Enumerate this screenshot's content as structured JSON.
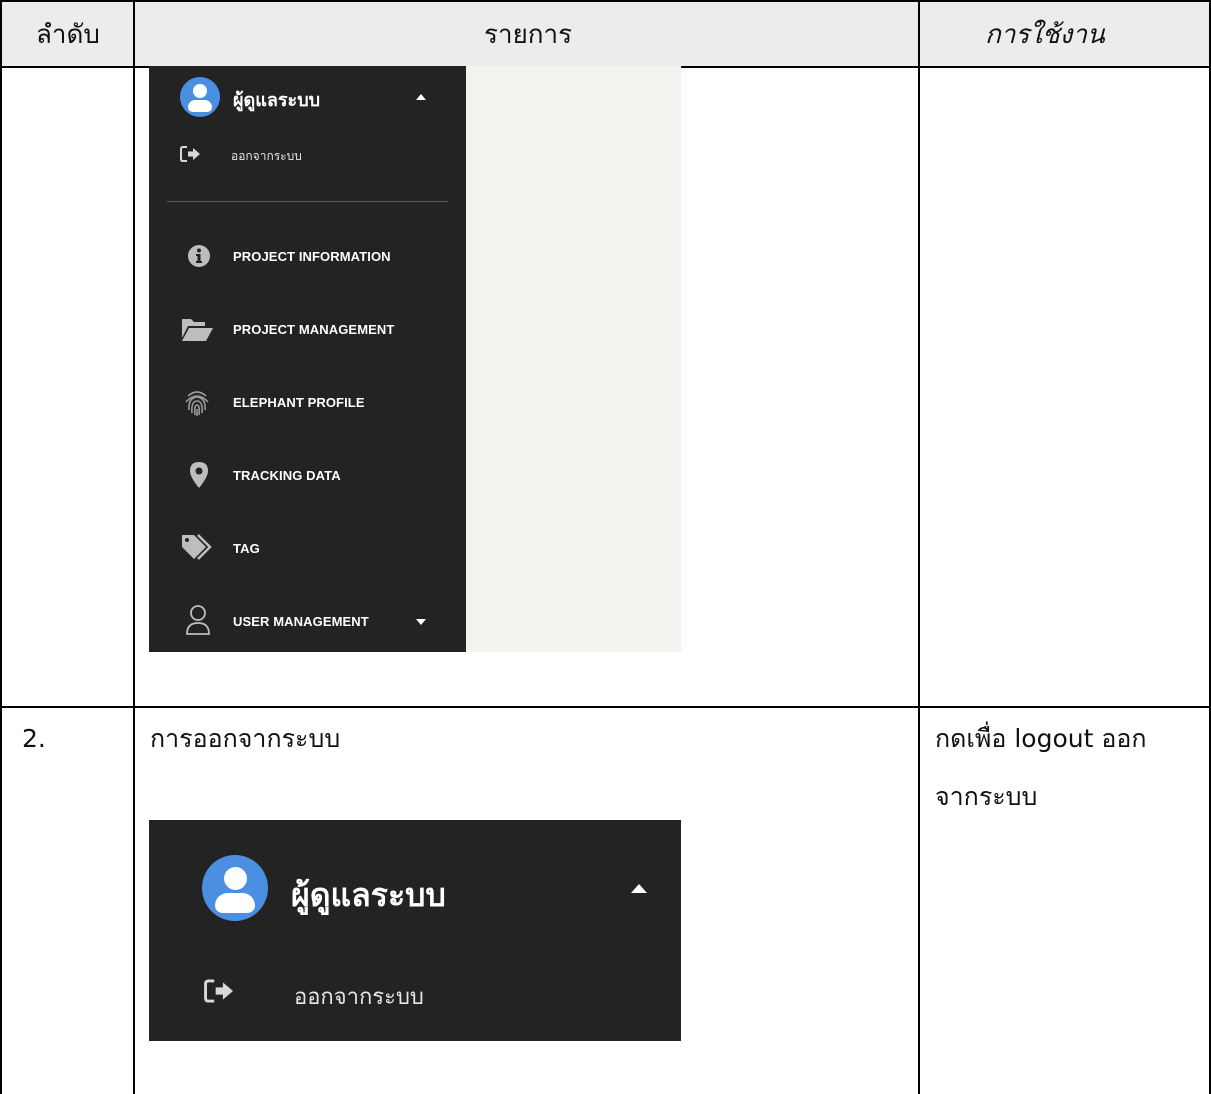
{
  "table": {
    "headers": [
      "ลำดับ",
      "รายการ",
      "การใช้งาน"
    ],
    "row2": {
      "number": "2.",
      "item": "การออกจากระบบ",
      "usage_line1": "กดเพื่อ logout ออก",
      "usage_line2": "จากระบบ"
    }
  },
  "sidebar": {
    "user_name": "ผู้ดูแลระบบ",
    "logout_label": "ออกจากระบบ",
    "items": [
      {
        "label": "PROJECT INFORMATION",
        "icon": "info-circle-icon"
      },
      {
        "label": "PROJECT MANAGEMENT",
        "icon": "folder-open-icon"
      },
      {
        "label": "ELEPHANT PROFILE",
        "icon": "fingerprint-icon"
      },
      {
        "label": "TRACKING DATA",
        "icon": "map-marker-icon"
      },
      {
        "label": "TAG",
        "icon": "tags-icon"
      },
      {
        "label": "USER MANAGEMENT",
        "icon": "user-icon"
      }
    ]
  },
  "zoomed": {
    "user_name": "ผู้ดูแลระบบ",
    "logout_label": "ออกจากระบบ"
  },
  "colors": {
    "sidebar_bg": "#232323",
    "avatar_blue": "#4a8fe2",
    "content_bg": "#f3f2ee"
  }
}
